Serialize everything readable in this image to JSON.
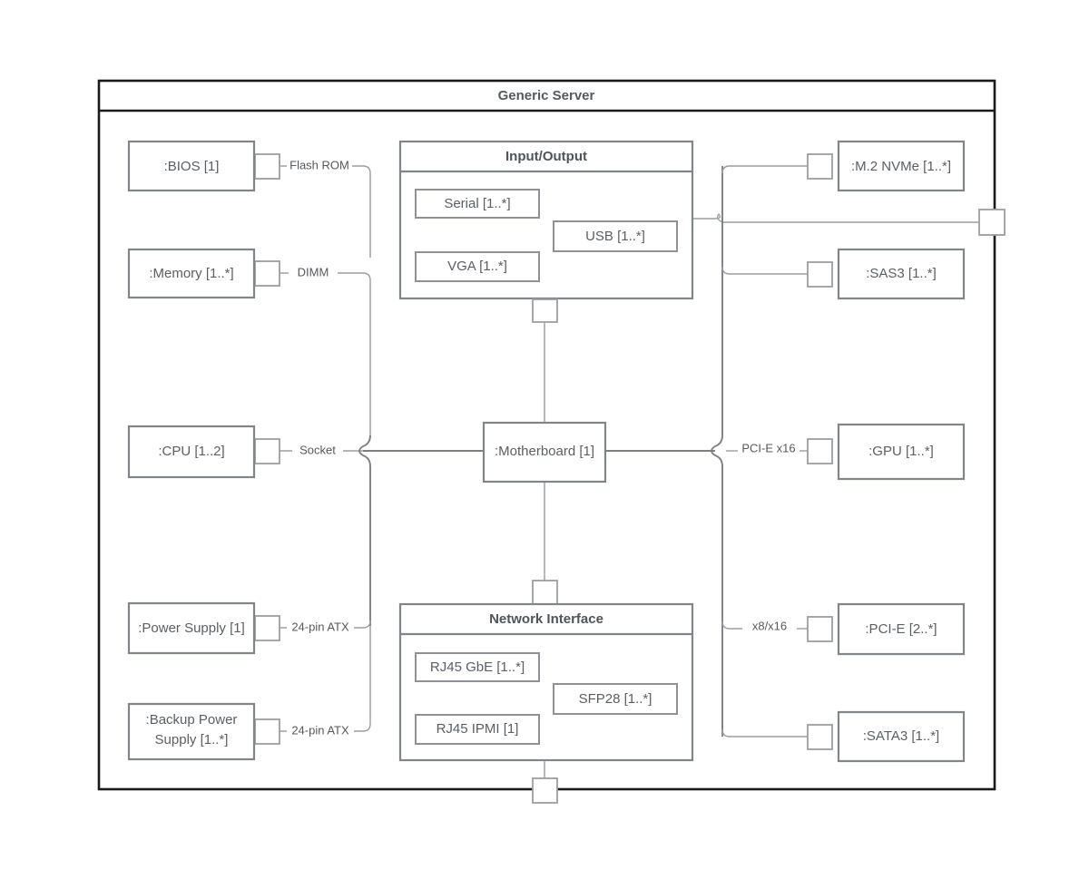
{
  "diagram": {
    "type": "uml-component-diagram",
    "container": {
      "title": "Generic Server"
    },
    "components": {
      "bios": {
        "label": ":BIOS [1]"
      },
      "memory": {
        "label": ":Memory [1..*]"
      },
      "cpu": {
        "label": ":CPU [1..2]"
      },
      "power_supply": {
        "label": ":Power Supply [1]"
      },
      "backup_power": {
        "label": ":Backup Power",
        "label2": "Supply [1..*]"
      },
      "motherboard": {
        "label": ":Motherboard [1]"
      },
      "m2_nvme": {
        "label": ":M.2 NVMe [1..*]"
      },
      "sas3": {
        "label": ":SAS3 [1..*]"
      },
      "gpu": {
        "label": ":GPU [1..*]"
      },
      "pcie": {
        "label": ":PCI-E [2..*]"
      },
      "sata3": {
        "label": ":SATA3 [1..*]"
      }
    },
    "composites": {
      "input_output": {
        "title": "Input/Output",
        "parts": [
          {
            "label": "Serial [1..*]"
          },
          {
            "label": "USB [1..*]"
          },
          {
            "label": "VGA [1..*]"
          }
        ]
      },
      "network_interface": {
        "title": "Network Interface",
        "parts": [
          {
            "label": "RJ45 GbE [1..*]"
          },
          {
            "label": "SFP28 [1..*]"
          },
          {
            "label": "RJ45 IPMI [1]"
          }
        ]
      }
    },
    "connector_labels": {
      "flash_rom": "Flash ROM",
      "dimm": "DIMM",
      "socket": "Socket",
      "atx_primary": "24-pin ATX",
      "atx_backup": "24-pin ATX",
      "pcie_x16": "PCI-E x16",
      "pcie_x8_x16": "x8/x16"
    },
    "colors": {
      "frame_border": "#1a1a1a",
      "component_border": "#808589",
      "sub_border": "#8e9296",
      "port_border": "#9a9ea2",
      "connector": "#9a9ea2",
      "connector_strong": "#7c8084",
      "text": "#5a5f63",
      "title_text": "#4f5458",
      "background": "#ffffff"
    }
  }
}
